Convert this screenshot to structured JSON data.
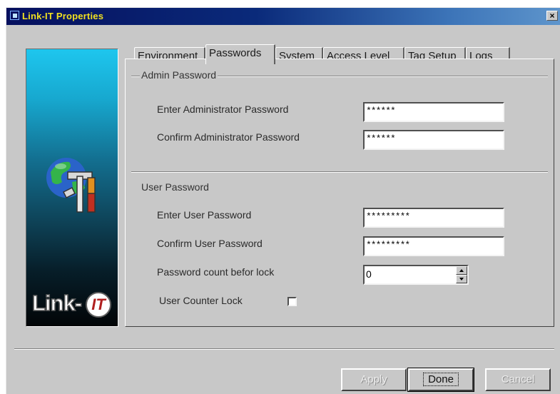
{
  "window": {
    "title": "Link-IT Properties",
    "close_glyph": "×"
  },
  "logo": {
    "word": "Link-",
    "mark": "IT",
    "icon": "globe-tools-icon"
  },
  "tabs": [
    "Environment",
    "Passwords",
    "System",
    "Access Level",
    "Tag Setup",
    "Logs"
  ],
  "active_tab": "Passwords",
  "admin": {
    "group_label": "Admin Password",
    "enter_label": "Enter Administrator Password",
    "enter_value": "******",
    "confirm_label": "Confirm Administrator Password",
    "confirm_value": "******"
  },
  "user": {
    "group_label": "User Password",
    "enter_label": "Enter User Password",
    "enter_value": "*********",
    "confirm_label": "Confirm User Password",
    "confirm_value": "*********",
    "count_label": "Password count befor lock",
    "count_value": "0",
    "lock_label": "User Counter Lock",
    "lock_checked": false
  },
  "buttons": {
    "apply": "Apply",
    "done": "Done",
    "cancel": "Cancel"
  },
  "colors": {
    "title_text": "#f0e020",
    "face": "#c8c8c8",
    "title_bar": "#06105e"
  }
}
